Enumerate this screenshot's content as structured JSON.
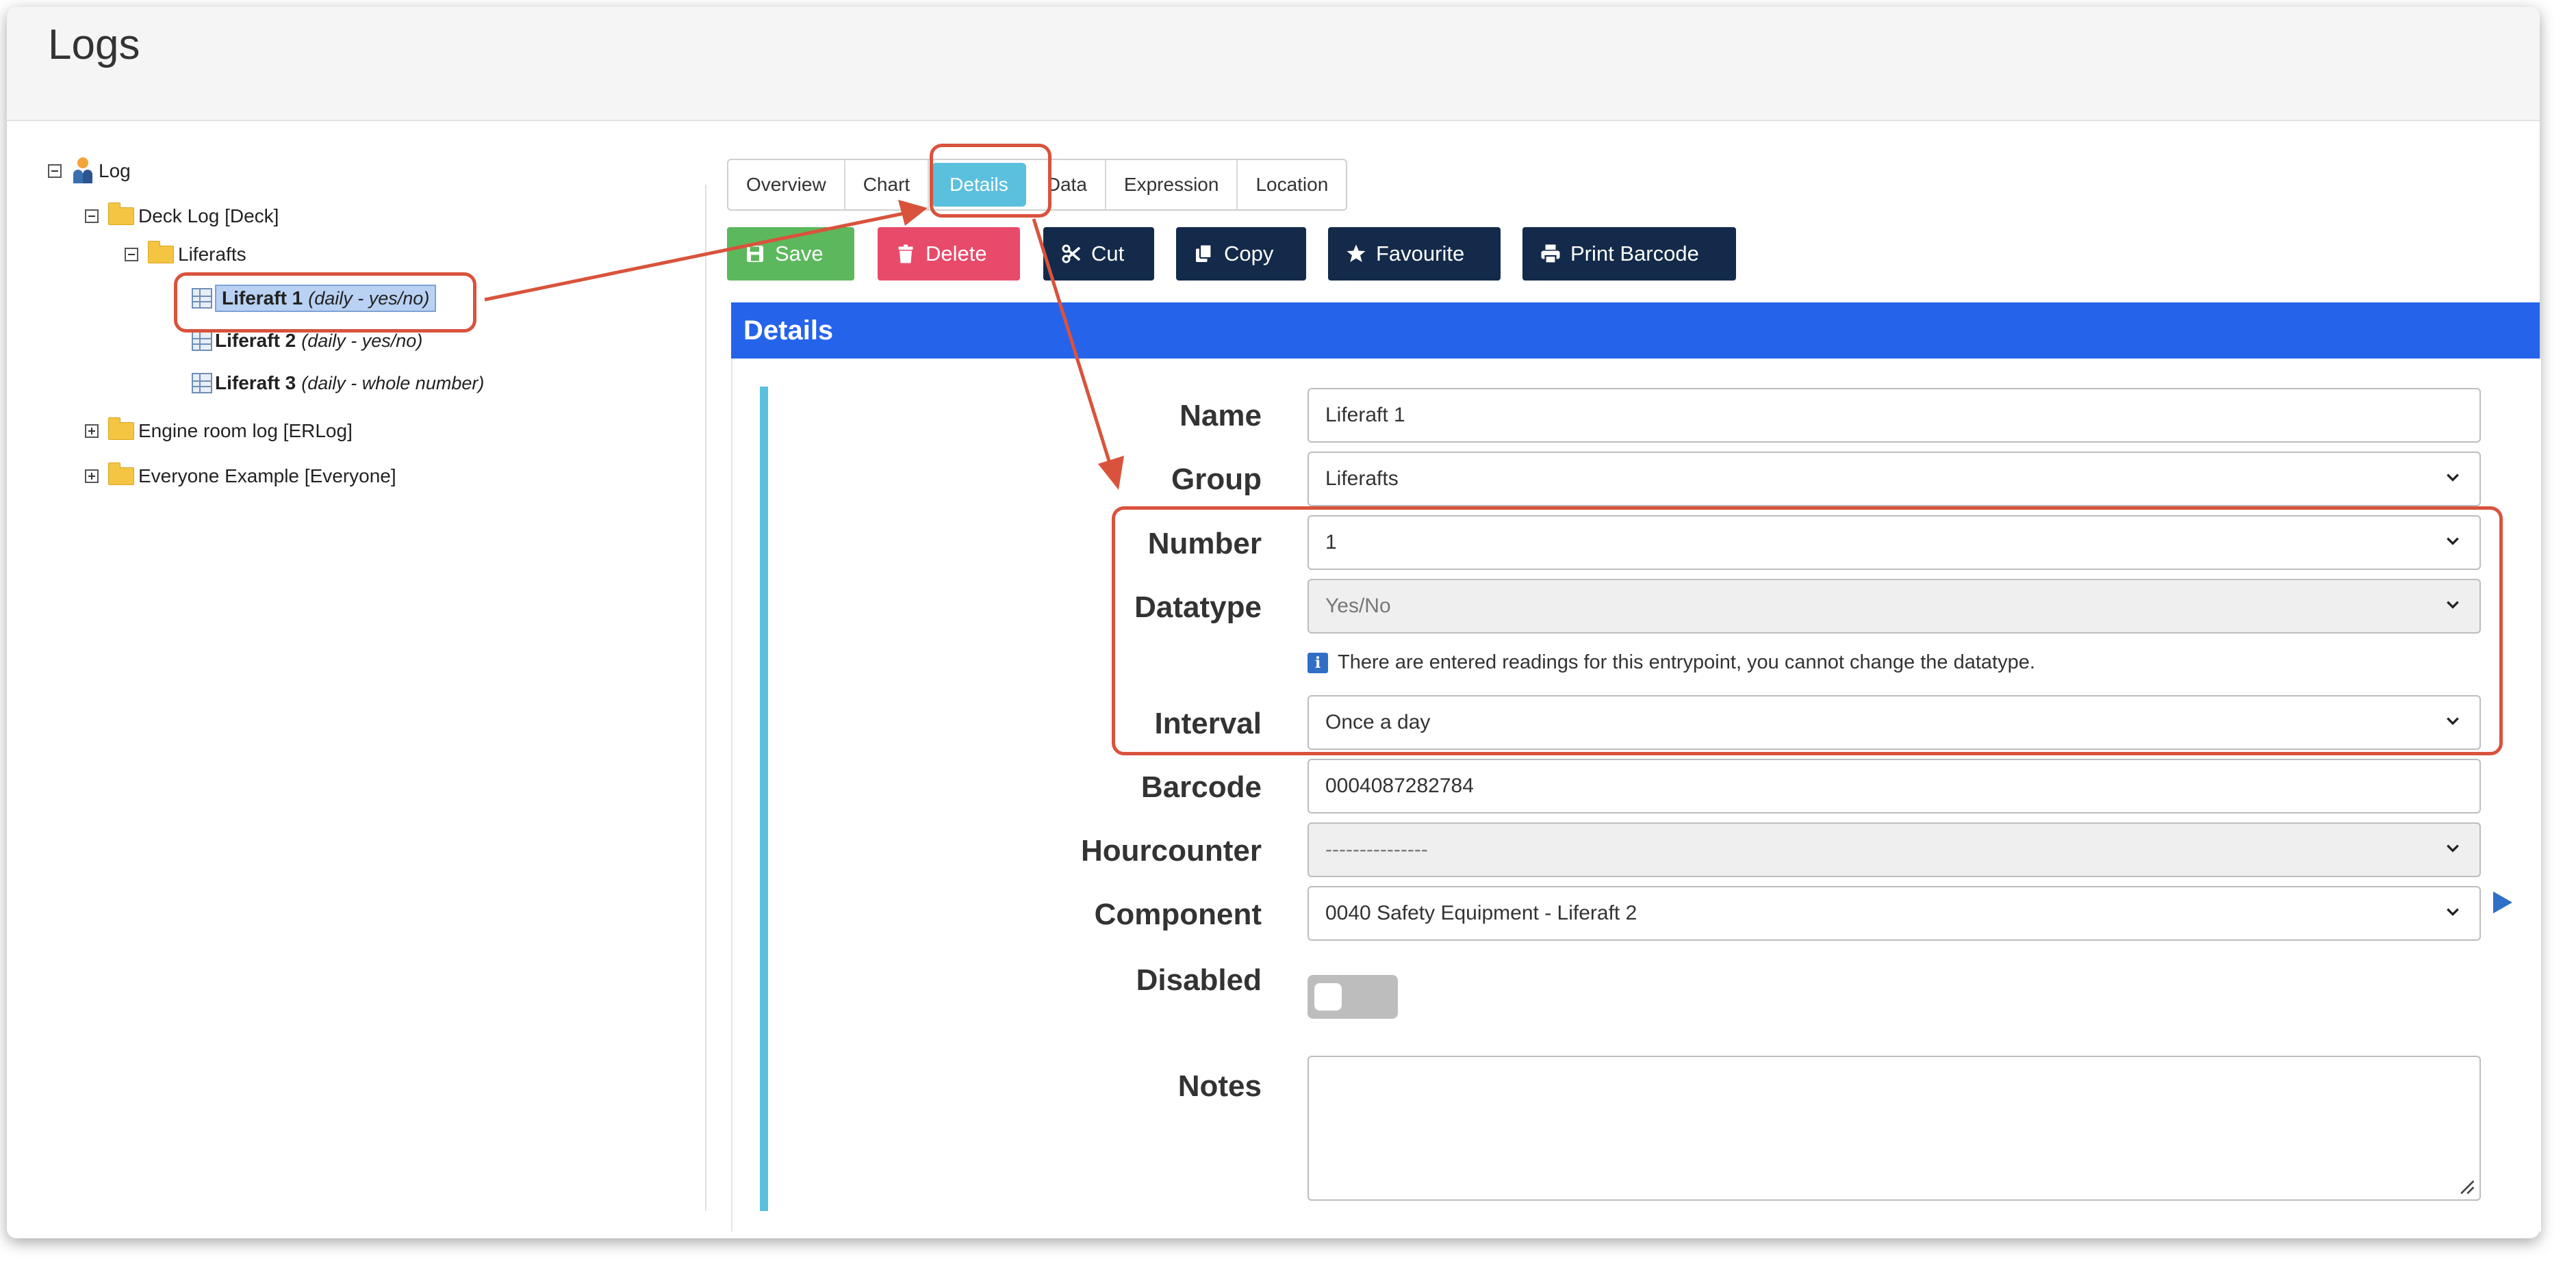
{
  "page_title": "Logs",
  "tree": {
    "root_label": "Log",
    "deck_log": "Deck Log [Deck]",
    "liferafts": "Liferafts",
    "items": [
      {
        "name": "Liferaft 1",
        "sub": "(daily - yes/no)"
      },
      {
        "name": "Liferaft 2",
        "sub": "(daily - yes/no)"
      },
      {
        "name": "Liferaft 3",
        "sub": "(daily - whole number)"
      }
    ],
    "engine_room": "Engine room log [ERLog]",
    "everyone": "Everyone Example [Everyone]"
  },
  "tabs": [
    "Overview",
    "Chart",
    "Details",
    "Data",
    "Expression",
    "Location"
  ],
  "active_tab": "Details",
  "toolbar": {
    "save": "Save",
    "delete": "Delete",
    "cut": "Cut",
    "copy": "Copy",
    "favourite": "Favourite",
    "print_barcode": "Print Barcode"
  },
  "panel_title": "Details",
  "form": {
    "name": {
      "label": "Name",
      "value": "Liferaft 1"
    },
    "group": {
      "label": "Group",
      "value": "Liferafts"
    },
    "number": {
      "label": "Number",
      "value": "1"
    },
    "datatype": {
      "label": "Datatype",
      "value": "Yes/No"
    },
    "datatype_info": "There are entered readings for this entrypoint, you cannot change the datatype.",
    "interval": {
      "label": "Interval",
      "value": "Once a day"
    },
    "barcode": {
      "label": "Barcode",
      "value": "0004087282784"
    },
    "hourcounter": {
      "label": "Hourcounter",
      "value": "---------------"
    },
    "component": {
      "label": "Component",
      "value": "0040 Safety Equipment - Liferaft 2"
    },
    "disabled": {
      "label": "Disabled",
      "on": false
    },
    "notes": {
      "label": "Notes",
      "value": ""
    }
  },
  "colors": {
    "save": "#5cb85c",
    "delete": "#e84a6a",
    "dark_button": "#132a4a",
    "tab_active": "#5bc0de",
    "panel_header": "#2563eb",
    "annotation": "#d9533c"
  }
}
